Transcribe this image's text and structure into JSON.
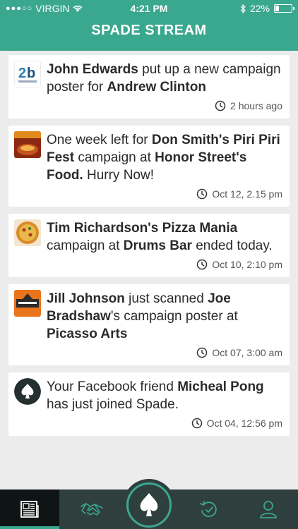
{
  "status_bar": {
    "carrier": "VIRGIN",
    "time": "4:21 PM",
    "battery": "22%",
    "battery_level": 0.22
  },
  "header": {
    "title": "SPADE STREAM"
  },
  "feed": [
    {
      "segments": [
        {
          "t": "John Edwards",
          "b": true
        },
        {
          "t": " put up a new campaign poster for ",
          "b": false
        },
        {
          "t": "Andrew Clinton",
          "b": true
        }
      ],
      "time": "2 hours ago",
      "thumb": "logo-2b-icon"
    },
    {
      "segments": [
        {
          "t": "One week left for ",
          "b": false
        },
        {
          "t": "Don Smith's Piri Piri Fest",
          "b": true
        },
        {
          "t": " campaign at ",
          "b": false
        },
        {
          "t": "Honor Street's Food.",
          "b": true
        },
        {
          "t": " Hurry Now!",
          "b": false
        }
      ],
      "time": "Oct 12, 2.15 pm",
      "thumb": "food-poster-icon"
    },
    {
      "segments": [
        {
          "t": "Tim Richardson's Pizza Mania",
          "b": true
        },
        {
          "t": " campaign at ",
          "b": false
        },
        {
          "t": "Drums Bar",
          "b": true
        },
        {
          "t": " ended today.",
          "b": false
        }
      ],
      "time": "Oct 10, 2:10 pm",
      "thumb": "pizza-icon"
    },
    {
      "segments": [
        {
          "t": "Jill Johnson",
          "b": true
        },
        {
          "t": " just scanned ",
          "b": false
        },
        {
          "t": "Joe Bradshaw",
          "b": true
        },
        {
          "t": "'s campaign poster at ",
          "b": false
        },
        {
          "t": "Picasso Arts",
          "b": true
        }
      ],
      "time": "Oct 07, 3:00 am",
      "thumb": "latitude-logo-icon"
    },
    {
      "segments": [
        {
          "t": "Your Facebook friend ",
          "b": false
        },
        {
          "t": "Micheal Pong",
          "b": true
        },
        {
          "t": " has just joined Spade.",
          "b": false
        }
      ],
      "time": "Oct 04, 12:56 pm",
      "thumb": "spade-avatar-icon"
    }
  ],
  "tabs": [
    {
      "icon": "newspaper-icon",
      "active": true
    },
    {
      "icon": "handshake-icon",
      "active": false
    },
    {
      "icon": "spade-icon",
      "active": false
    },
    {
      "icon": "history-icon",
      "active": false
    },
    {
      "icon": "profile-icon",
      "active": false
    }
  ],
  "colors": {
    "accent": "#3aa78f",
    "tabbar": "#2f3f3e",
    "active_tab": "#0f1414"
  }
}
